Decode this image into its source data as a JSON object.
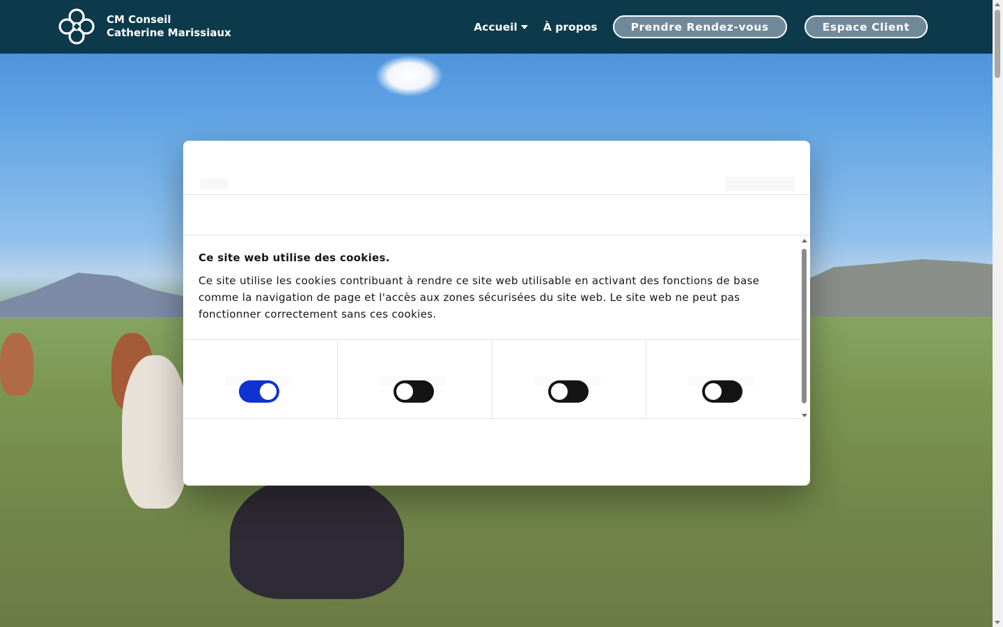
{
  "colors": {
    "header_bg": "#0c3a4a",
    "pill_bg": "#70899a",
    "toggle_on": "#1032cf",
    "toggle_off": "#141414"
  },
  "header": {
    "brand_line1": "CM Conseil",
    "brand_line2": "Catherine Marissiaux",
    "logo_icon": "quatrefoil-logo-icon",
    "nav": {
      "home": "Accueil",
      "about": "À propos"
    },
    "appointment_button": "Prendre Rendez-vous",
    "client_button": "Espace Client"
  },
  "cookie_dialog": {
    "title": "Ce site web utilise des cookies.",
    "description": "Ce site utilise les cookies contribuant à rendre ce site web utilisable en activant des fonctions de base comme la navigation de page et l'accès aux zones sécurisées du site web. Le site web ne peut pas fonctionner correctement sans ces cookies.",
    "toggles": [
      {
        "checked": true
      },
      {
        "checked": false
      },
      {
        "checked": false
      },
      {
        "checked": false
      }
    ]
  }
}
